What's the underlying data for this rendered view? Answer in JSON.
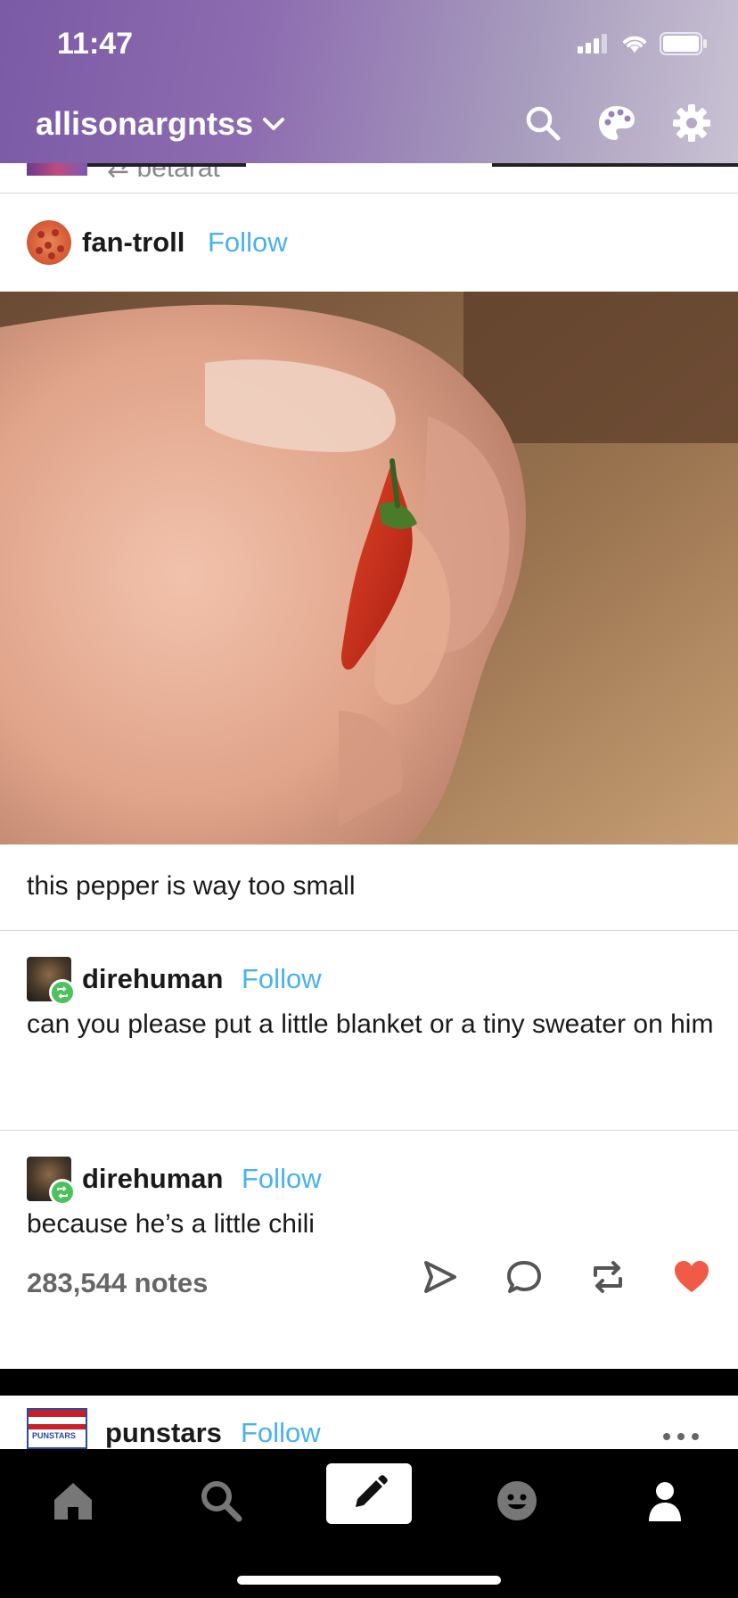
{
  "status_bar": {
    "time": "11:47"
  },
  "header": {
    "blog_name": "allisonargntss",
    "icons": [
      "chevron-down-icon",
      "search-icon",
      "palette-icon",
      "gear-icon"
    ]
  },
  "previous_post": {
    "reblog_name": "⇄ betarat"
  },
  "post": {
    "op": {
      "username": "fan-troll",
      "follow_label": "Follow"
    },
    "caption": "this pepper is way too small",
    "reblogs": [
      {
        "username": "direhuman",
        "follow_label": "Follow",
        "text": "can you please put a little blanket or a tiny sweater on him"
      },
      {
        "username": "direhuman",
        "follow_label": "Follow",
        "text": "because he’s a little chili"
      }
    ],
    "notes": "283,544 notes",
    "actions": [
      "send-icon",
      "comment-icon",
      "reblog-icon",
      "heart-icon"
    ]
  },
  "next_post": {
    "username": "punstars",
    "follow_label": "Follow",
    "avatar_text": "PUNSTARS"
  },
  "tabbar": {
    "tabs": [
      "home-icon",
      "search-icon",
      "compose-icon",
      "activity-icon",
      "account-icon"
    ]
  },
  "colors": {
    "follow": "#4ab2ea",
    "heart": "#f05a46",
    "reblog_badge": "#4cc35a"
  }
}
